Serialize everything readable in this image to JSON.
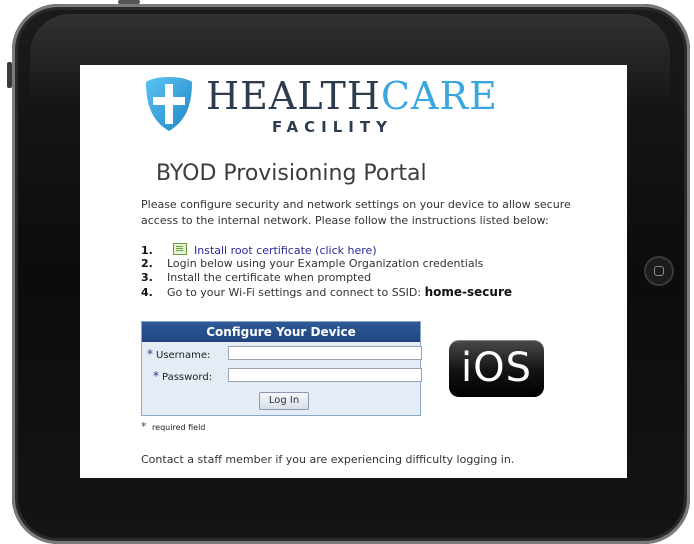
{
  "brand": {
    "name_part1": "HEALTH",
    "name_part2": "CARE",
    "subtitle": "FACILITY",
    "accent_color": "#3aa7e0",
    "dark_color": "#2d3c4f",
    "logo_icon": "shield-cross-icon"
  },
  "portal": {
    "title": "BYOD Provisioning Portal",
    "intro": "Please configure security and network settings on your device to allow secure access to the internal network. Please follow the instructions listed below:"
  },
  "steps": [
    {
      "num": "1.",
      "text": "Install root certificate (click here)",
      "icon": "certificate-icon"
    },
    {
      "num": "2.",
      "text": "Login below using your Example Organization credentials"
    },
    {
      "num": "3.",
      "text": "Install the certificate when prompted"
    },
    {
      "num": "4.",
      "text": "Go to your Wi-Fi settings and connect to SSID: ",
      "ssid": "home-secure"
    }
  ],
  "form": {
    "title": "Configure Your Device",
    "username_label": "Username:",
    "username_value": "",
    "password_label": "Password:",
    "password_value": "",
    "required_marker": "*",
    "login_label": "Log In",
    "header_color": "#1f4580"
  },
  "required_note": "required field",
  "platform_badge": "iOS",
  "contact": "Contact a staff member if you are experiencing difficulty logging in."
}
